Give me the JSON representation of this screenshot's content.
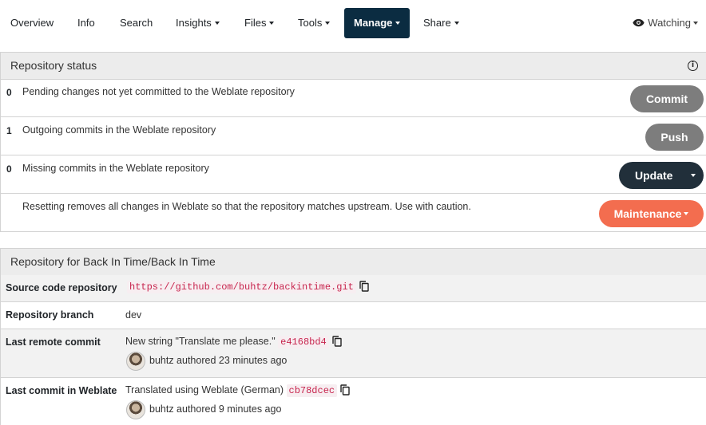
{
  "nav": {
    "items": [
      {
        "label": "Overview",
        "dropdown": false,
        "active": false
      },
      {
        "label": "Info",
        "dropdown": false,
        "active": false
      },
      {
        "label": "Search",
        "dropdown": false,
        "active": false
      },
      {
        "label": "Insights",
        "dropdown": true,
        "active": false
      },
      {
        "label": "Files",
        "dropdown": true,
        "active": false
      },
      {
        "label": "Tools",
        "dropdown": true,
        "active": false
      },
      {
        "label": "Manage",
        "dropdown": true,
        "active": true
      },
      {
        "label": "Share",
        "dropdown": true,
        "active": false
      }
    ],
    "watching": "Watching"
  },
  "repo_status": {
    "title": "Repository status",
    "rows": [
      {
        "count": "0",
        "text": "Pending changes not yet committed to the Weblate repository",
        "button": "Commit"
      },
      {
        "count": "1",
        "text": "Outgoing commits in the Weblate repository",
        "button": "Push"
      },
      {
        "count": "0",
        "text": "Missing commits in the Weblate repository",
        "button": "Update"
      },
      {
        "count": "",
        "text": "Resetting removes all changes in Weblate so that the repository matches upstream. Use with caution.",
        "button": "Maintenance"
      }
    ]
  },
  "repo_info": {
    "title": "Repository for Back In Time/Back In Time",
    "source_label": "Source code repository",
    "source_url": "https://github.com/buhtz/backintime.git",
    "branch_label": "Repository branch",
    "branch": "dev",
    "remote_label": "Last remote commit",
    "remote_message": "New string \"Translate me please.\"",
    "remote_hash": "e4168bd4",
    "remote_author": "buhtz authored 23 minutes ago",
    "weblate_label": "Last commit in Weblate",
    "weblate_message": "Translated using Weblate (German)",
    "weblate_hash": "cb78dcec",
    "weblate_author": "buhtz authored 9 minutes ago"
  },
  "colors": {
    "nav_active": "#0b2c41",
    "btn_grey": "#7d7d7d",
    "btn_dark": "#212f3a",
    "btn_maintenance": "#f36d4f",
    "code_text": "#c7254e"
  }
}
